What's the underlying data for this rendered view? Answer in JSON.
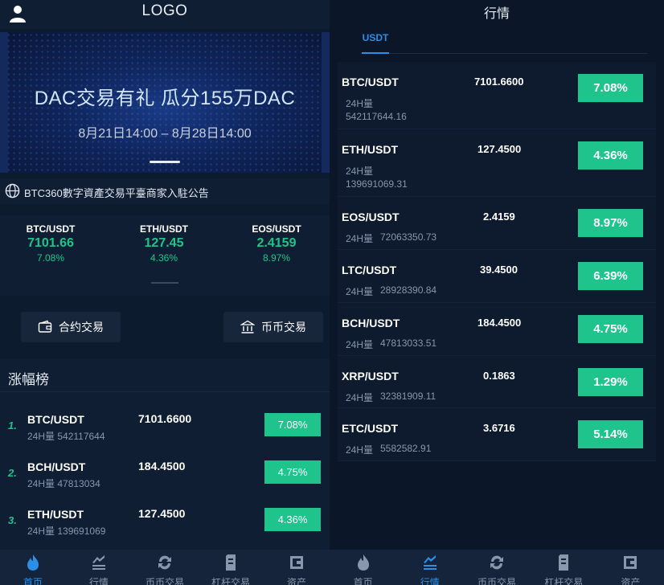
{
  "left": {
    "logo": "LOGO",
    "banner": {
      "headline": "DAC交易有礼 瓜分155万DAC",
      "date_range": "8月21日14:00 – 8月28日14:00"
    },
    "notice": "BTC360數字資產交易平臺商家入駐公告",
    "tickers": [
      {
        "pair": "BTC/USDT",
        "price": "7101.66",
        "change": "7.08%"
      },
      {
        "pair": "ETH/USDT",
        "price": "127.45",
        "change": "4.36%"
      },
      {
        "pair": "EOS/USDT",
        "price": "2.4159",
        "change": "8.97%"
      }
    ],
    "quick_buttons": {
      "contract": "合约交易",
      "coin": "币币交易"
    },
    "gainers": {
      "title": "涨幅榜",
      "rows": [
        {
          "rank": "1.",
          "pair": "BTC/USDT",
          "volume": "24H量 542117644",
          "price": "7101.6600",
          "change": "7.08%"
        },
        {
          "rank": "2.",
          "pair": "BCH/USDT",
          "volume": "24H量 47813034",
          "price": "184.4500",
          "change": "4.75%"
        },
        {
          "rank": "3.",
          "pair": "ETH/USDT",
          "volume": "24H量 139691069",
          "price": "127.4500",
          "change": "4.36%"
        }
      ]
    }
  },
  "tabbar_left": [
    {
      "label": "首页",
      "icon": "flame-icon",
      "active": true
    },
    {
      "label": "行情",
      "icon": "chart-icon",
      "active": false
    },
    {
      "label": "币币交易",
      "icon": "exchange-icon",
      "active": false
    },
    {
      "label": "杠杆交易",
      "icon": "leverage-icon",
      "active": false
    },
    {
      "label": "资产",
      "icon": "wallet-icon",
      "active": false
    }
  ],
  "right": {
    "title": "行情",
    "market_tab": "USDT",
    "volume_label": "24H量",
    "rows": [
      {
        "pair": "BTC/USDT",
        "price": "7101.6600",
        "volume": "542117644.16",
        "change": "7.08%"
      },
      {
        "pair": "ETH/USDT",
        "price": "127.4500",
        "volume": "139691069.31",
        "change": "4.36%"
      },
      {
        "pair": "EOS/USDT",
        "price": "2.4159",
        "volume": "72063350.73",
        "change": "8.97%"
      },
      {
        "pair": "LTC/USDT",
        "price": "39.4500",
        "volume": "28928390.84",
        "change": "6.39%"
      },
      {
        "pair": "BCH/USDT",
        "price": "184.4500",
        "volume": "47813033.51",
        "change": "4.75%"
      },
      {
        "pair": "XRP/USDT",
        "price": "0.1863",
        "volume": "32381909.11",
        "change": "1.29%"
      },
      {
        "pair": "ETC/USDT",
        "price": "3.6716",
        "volume": "5582582.91",
        "change": "5.14%"
      }
    ]
  },
  "tabbar_right": [
    {
      "label": "首页",
      "icon": "flame-icon",
      "active": false
    },
    {
      "label": "行情",
      "icon": "chart-icon",
      "active": true
    },
    {
      "label": "币币交易",
      "icon": "exchange-icon",
      "active": false
    },
    {
      "label": "杠杆交易",
      "icon": "leverage-icon",
      "active": false
    },
    {
      "label": "资产",
      "icon": "wallet-icon",
      "active": false
    }
  ],
  "colors": {
    "accent_green": "#1ec48c",
    "accent_blue": "#2a8fe6",
    "background": "#0b1628",
    "panel": "#0f1e33"
  }
}
